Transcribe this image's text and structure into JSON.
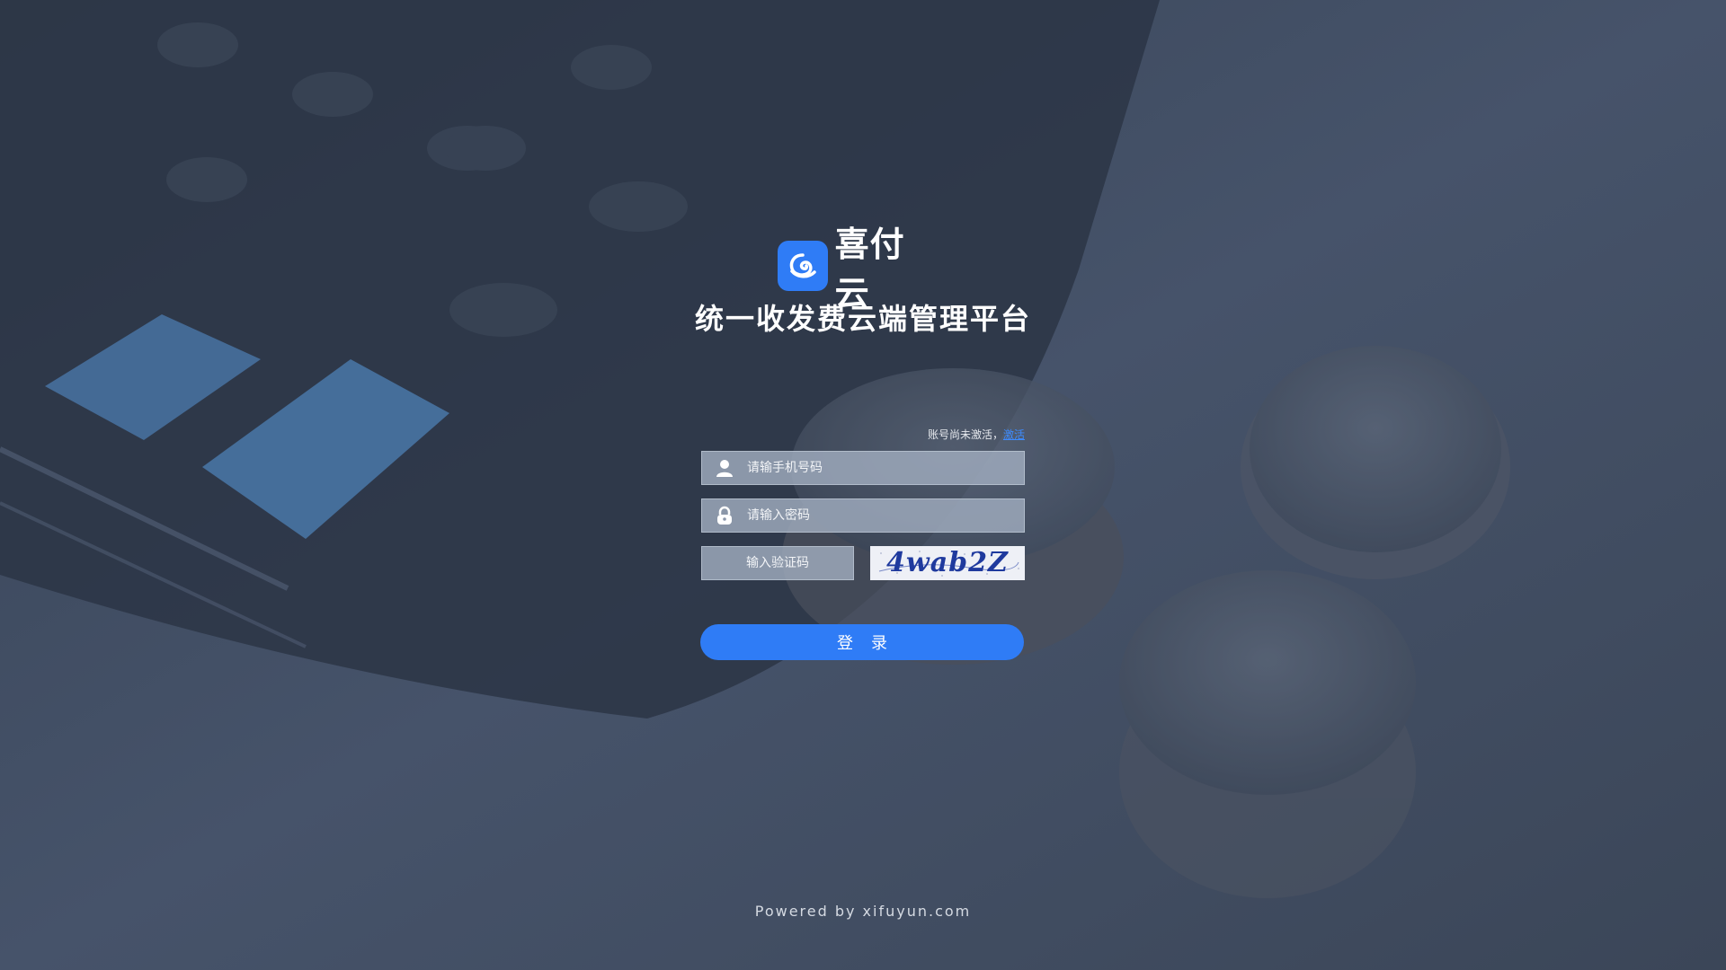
{
  "brand": {
    "logo_icon": "spiral-cloud-icon",
    "name": "喜付云",
    "color": "#2f7cf6"
  },
  "platform_title": "统一收发费云端管理平台",
  "activation": {
    "prompt": "账号尚未激活，",
    "link_label": "激活"
  },
  "form": {
    "phone": {
      "icon": "user-icon",
      "placeholder": "请输手机号码",
      "value": ""
    },
    "password": {
      "icon": "lock-icon",
      "placeholder": "请输入密码",
      "value": ""
    },
    "captcha": {
      "placeholder": "输入验证码",
      "value": "",
      "image_text": "4wab2Z"
    }
  },
  "login_button": {
    "label": "登录",
    "color": "#2f7cf6"
  },
  "footer": "Powered by xifuyun.com"
}
